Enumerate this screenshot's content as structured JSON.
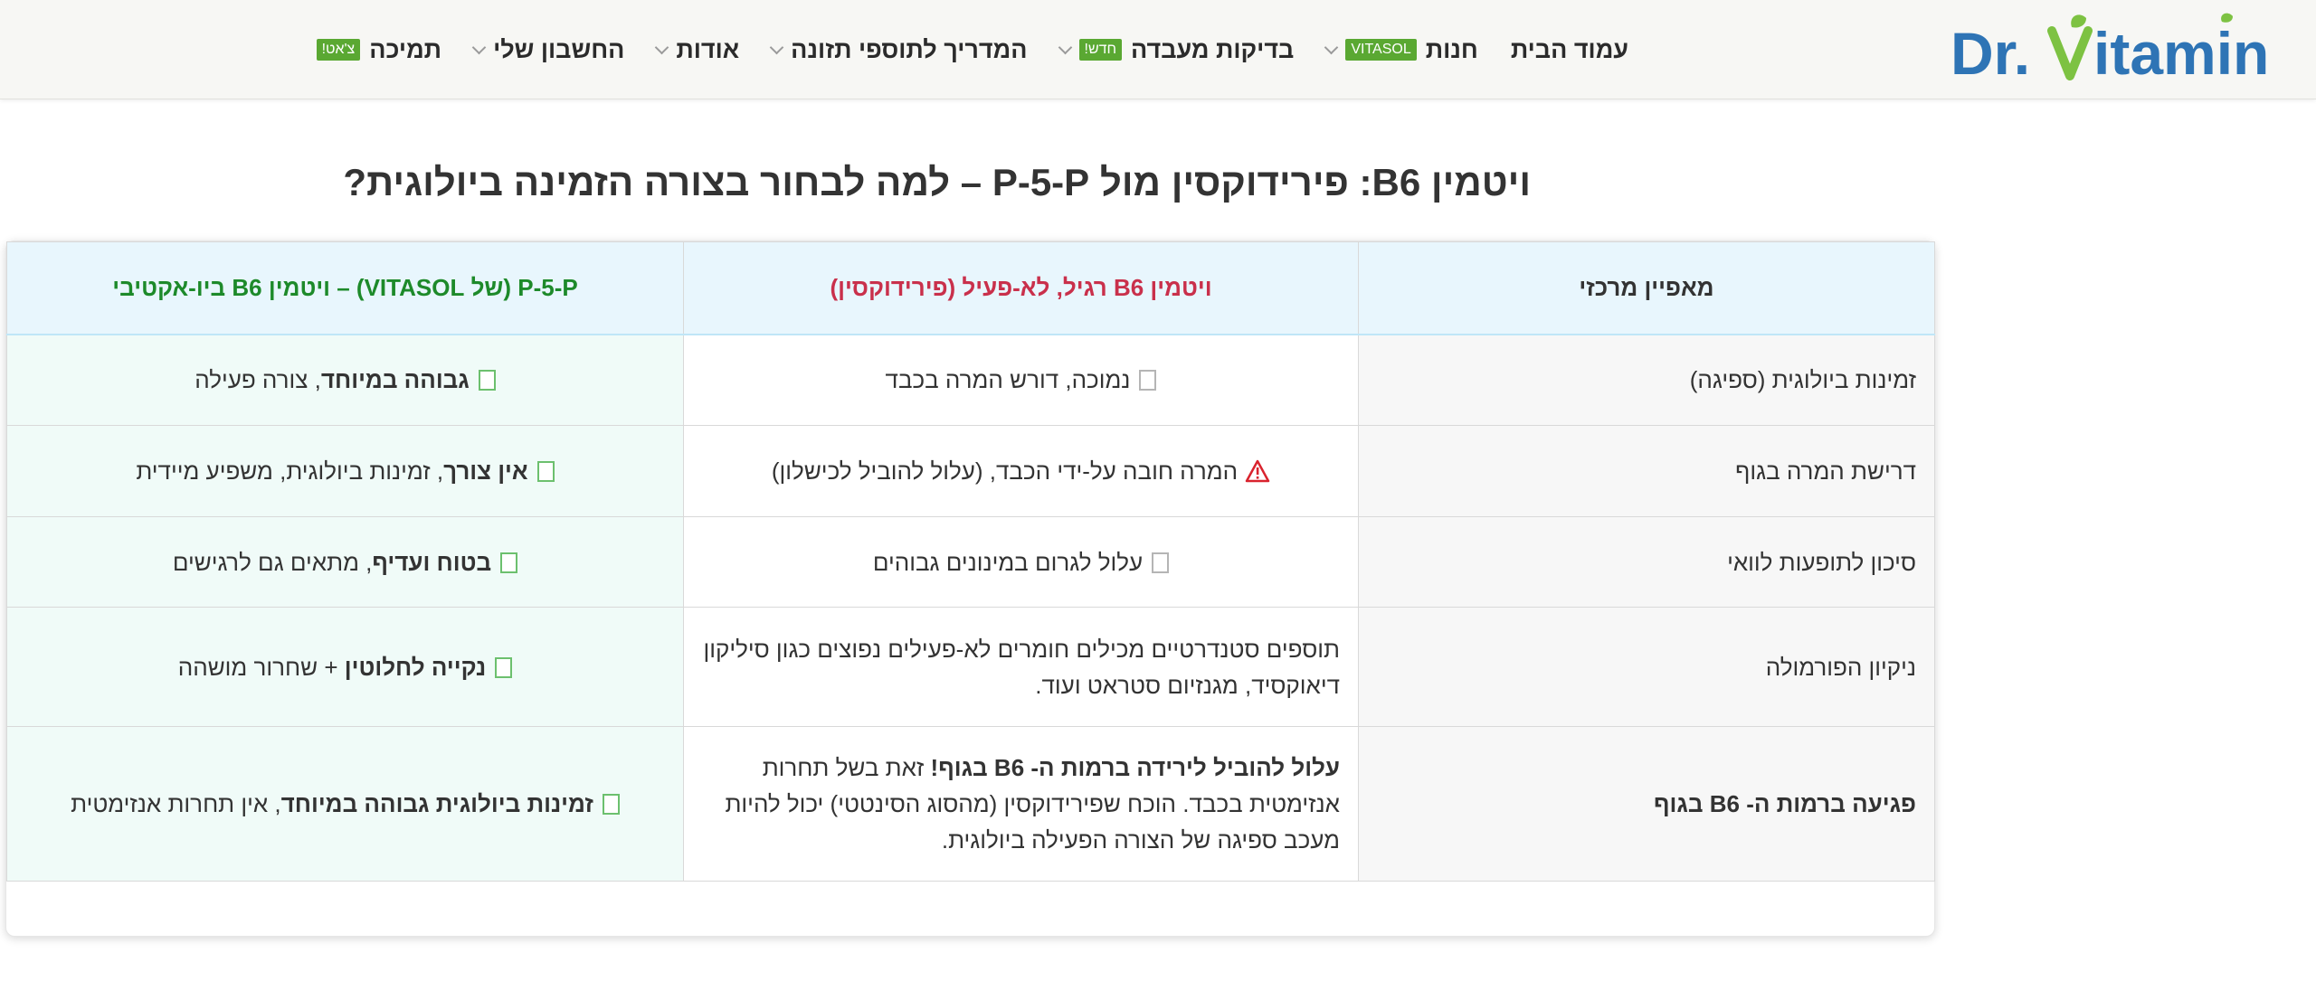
{
  "header": {
    "logo": {
      "text_left": "Dr.",
      "text_right": "itamin",
      "brand_blue": "#2e74b5",
      "brand_green": "#7dc242"
    },
    "nav": [
      {
        "label": "עמוד הבית",
        "has_chevron": false
      },
      {
        "label": "חנות",
        "badge": "VITASOL",
        "has_chevron": true
      },
      {
        "label": "בדיקות מעבדה",
        "badge": "חדש!",
        "has_chevron": true
      },
      {
        "label": "המדריך לתוספי תזונה",
        "has_chevron": true
      },
      {
        "label": "אודות",
        "has_chevron": true
      },
      {
        "label": "החשבון שלי",
        "has_chevron": true
      },
      {
        "label": "תמיכה",
        "badge": "צ'אט!",
        "has_chevron": false
      }
    ]
  },
  "page_title": "ויטמין B6: פירידוקסין מול P-5-P – למה לבחור בצורה הזמינה ביולוגית?",
  "table": {
    "headers": {
      "feature": "מאפיין מרכזי",
      "regular": "ויטמין B6 רגיל, לא-פעיל (פירידוקסין)",
      "p5p": "P-5-P (של VITASOL) – ויטמין B6 ביו-אקטיבי"
    },
    "rows": [
      {
        "feature": "זמינות ביולוגית (ספיגה)",
        "regular": {
          "icon": "empty-box",
          "text": "נמוכה, דורש המרה בכבד"
        },
        "p5p": {
          "icon": "checkbox",
          "bold": "גבוהה במיוחד",
          "text": ", צורה פעילה"
        }
      },
      {
        "feature": "דרישת המרה בגוף",
        "regular": {
          "icon": "warning",
          "text": "המרה חובה על-ידי הכבד, (עלול להוביל לכישלון)"
        },
        "p5p": {
          "icon": "checkbox",
          "bold": "אין צורך",
          "text": ", זמינות ביולוגית, משפיע מיידית"
        }
      },
      {
        "feature": "סיכון לתופעות לוואי",
        "regular": {
          "icon": "empty-box",
          "text": "עלול לגרום במינונים גבוהים"
        },
        "p5p": {
          "icon": "checkbox",
          "bold": "בטוח ועדיף",
          "text": ", מתאים גם לרגישים"
        }
      },
      {
        "feature": "ניקיון הפורמולה",
        "regular": {
          "text": "תוספים סטנדרטיים מכילים חומרים לא-פעילים נפוצים כגון סיליקון דיאוקסיד, מגנזיום סטראט ועוד."
        },
        "p5p": {
          "icon": "checkbox",
          "bold": "נקייה לחלוטין",
          "text": " + שחרור מושהה"
        }
      },
      {
        "feature": "פגיעה ברמות ה- B6 בגוף",
        "feature_bold": true,
        "regular": {
          "bold": "עלול להוביל לירידה ברמות ה- B6 בגוף!",
          "text": " זאת בשל תחרות אנזימטית בכבד. הוכח שפירידוקסין (מהסוג הסינטטי) יכול להיות מעכב ספיגה של הצורה הפעילה ביולוגית."
        },
        "p5p": {
          "icon": "checkbox",
          "bold": "זמינות ביולוגית גבוהה במיוחד",
          "text": ", אין תחרות אנזימטית"
        }
      }
    ]
  }
}
